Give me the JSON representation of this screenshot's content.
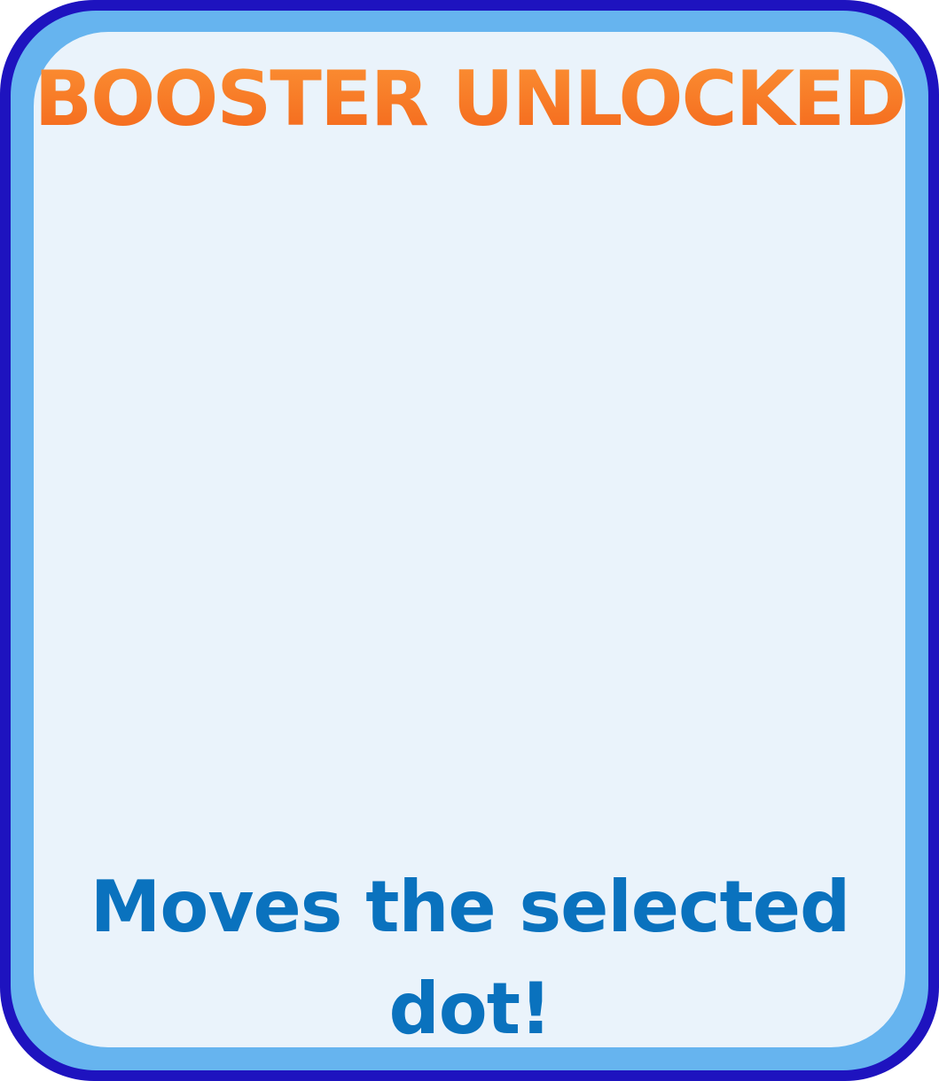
{
  "booster_dialog": {
    "title": "BOOSTER UNLOCKED",
    "description": "Moves the selected dot!",
    "colors": {
      "outer_border": "#1e13bf",
      "inner_border": "#66b4ef",
      "panel_fill": "#eaf3fb",
      "title_gradient_top": "#fb9134",
      "title_gradient_bottom": "#f4661b",
      "description_text": "#0a72be"
    }
  }
}
